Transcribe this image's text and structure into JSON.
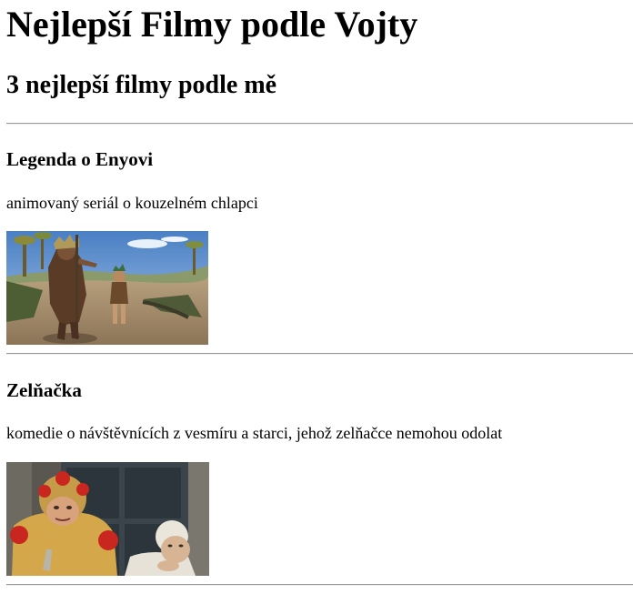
{
  "header": {
    "title": "Nejlepší Filmy podle Vojty",
    "subtitle": "3 nejlepší filmy podle mě"
  },
  "films": [
    {
      "name": "Legenda o Enyovi",
      "description": "animovaný seriál o kouzelném chlapci",
      "image": "animated-boy-and-chieftain-in-desert-scene"
    },
    {
      "name": "Zelňačka",
      "description": "komedie o návštěvnících z vesmíru a starci, jehož zelňačce nemohou odolat",
      "image": "alien-in-yellow-suit-and-old-man-scene"
    }
  ],
  "colors": {
    "text": "#000000",
    "rule": "#9a9a9a",
    "background": "#ffffff"
  }
}
